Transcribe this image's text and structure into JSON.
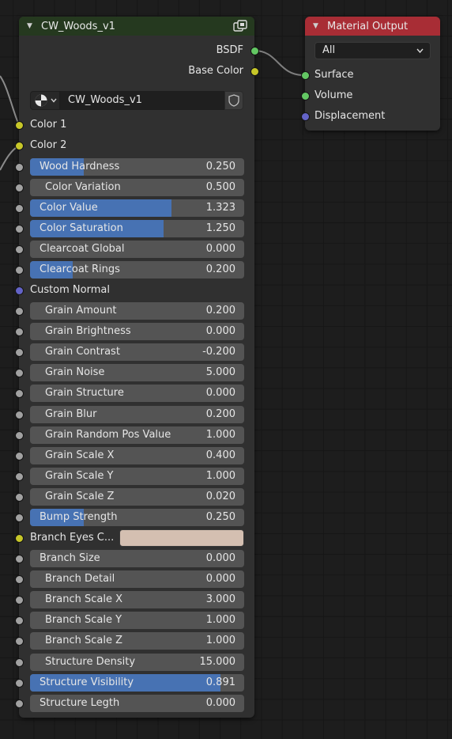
{
  "group_node": {
    "title": "CW_Woods_v1",
    "outputs": [
      {
        "label": "BSDF",
        "socket": "green"
      },
      {
        "label": "Base Color",
        "socket": "yellow"
      }
    ],
    "datablock": {
      "name": "CW_Woods_v1",
      "type_icon": "material-sphere-icon",
      "action_icon": "fake-user-shield-icon"
    },
    "color_inputs": [
      {
        "label": "Color 1"
      },
      {
        "label": "Color 2"
      }
    ],
    "params_a": [
      {
        "label": "Wood Hardness",
        "value": "0.250",
        "fill": 0.25
      },
      {
        "label": "Color Variation",
        "value": "0.500",
        "fill": null
      },
      {
        "label": "Color Value",
        "value": "1.323",
        "fill": 0.661
      },
      {
        "label": "Color Saturation",
        "value": "1.250",
        "fill": 0.625
      },
      {
        "label": "Clearcoat Global",
        "value": "0.000",
        "fill": 0.0
      },
      {
        "label": "Clearcoat Rings",
        "value": "0.200",
        "fill": 0.2
      }
    ],
    "custom_normal": {
      "label": "Custom Normal"
    },
    "params_b": [
      {
        "label": "Grain Amount",
        "value": "0.200",
        "fill": null
      },
      {
        "label": "Grain Brightness",
        "value": "0.000",
        "fill": null
      },
      {
        "label": "Grain Contrast",
        "value": "-0.200",
        "fill": null
      },
      {
        "label": "Grain Noise",
        "value": "5.000",
        "fill": null
      },
      {
        "label": "Grain Structure",
        "value": "0.000",
        "fill": null
      },
      {
        "label": "Grain Blur",
        "value": "0.200",
        "fill": null
      },
      {
        "label": "Grain Random Pos Value",
        "value": "1.000",
        "fill": null
      },
      {
        "label": "Grain Scale X",
        "value": "0.400",
        "fill": null
      },
      {
        "label": "Grain Scale Y",
        "value": "1.000",
        "fill": null
      },
      {
        "label": "Grain Scale Z",
        "value": "0.020",
        "fill": null
      },
      {
        "label": "Bump Strength",
        "value": "0.250",
        "fill": 0.25
      }
    ],
    "branch_eyes_color": {
      "label": "Branch Eyes C...",
      "color": "#d4bfb1"
    },
    "params_c": [
      {
        "label": "Branch Size",
        "value": "0.000",
        "fill": 0.0
      },
      {
        "label": "Branch Detail",
        "value": "0.000",
        "fill": null
      },
      {
        "label": "Branch Scale X",
        "value": "3.000",
        "fill": null
      },
      {
        "label": "Branch Scale Y",
        "value": "1.000",
        "fill": null
      },
      {
        "label": "Branch Scale Z",
        "value": "1.000",
        "fill": null
      },
      {
        "label": "Structure Density",
        "value": "15.000",
        "fill": null
      },
      {
        "label": "Structure Visibility",
        "value": "0.891",
        "fill": 0.891
      },
      {
        "label": "Structure Legth",
        "value": "0.000",
        "fill": 0.0
      }
    ]
  },
  "material_output": {
    "title": "Material Output",
    "target": "All",
    "inputs": [
      {
        "label": "Surface",
        "socket": "green"
      },
      {
        "label": "Volume",
        "socket": "green"
      },
      {
        "label": "Displacement",
        "socket": "blue"
      }
    ]
  },
  "colors": {
    "slider_fill": "#4772b3",
    "field_bg": "#545454",
    "group_header": "#25391f",
    "output_header": "#a82d35",
    "socket_yellow": "#c7c729",
    "socket_grey": "#a1a1a1",
    "socket_blue": "#6363c7",
    "socket_green": "#63c763"
  }
}
